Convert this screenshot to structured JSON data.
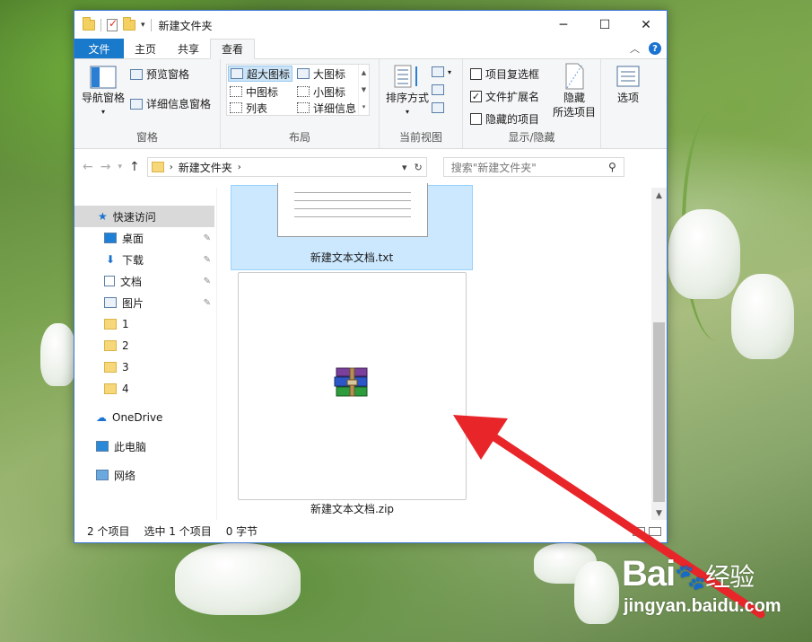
{
  "window": {
    "title": "新建文件夹",
    "controls": {
      "minimize": "─",
      "maximize": "☐",
      "close": "✕"
    }
  },
  "ribbon_tabs": {
    "file": "文件",
    "home": "主页",
    "share": "共享",
    "view": "查看",
    "help": "?"
  },
  "ribbon": {
    "panes": {
      "nav_pane": "导航窗格",
      "preview_pane": "预览窗格",
      "details_pane": "详细信息窗格",
      "label": "窗格"
    },
    "layout": {
      "items": [
        "超大图标",
        "大图标",
        "中图标",
        "小图标",
        "列表",
        "详细信息"
      ],
      "selected": "超大图标",
      "label": "布局"
    },
    "current_view": {
      "sort": "排序方式",
      "label": "当前视图"
    },
    "show_hide": {
      "item_checkboxes": "项目复选框",
      "file_extensions": "文件扩展名",
      "hidden_items": "隐藏的项目",
      "hide_selected_1": "隐藏",
      "hide_selected_2": "所选项目",
      "label": "显示/隐藏",
      "checked": {
        "item_checkboxes": false,
        "file_extensions": true,
        "hidden_items": false
      }
    },
    "options": "选项"
  },
  "address": {
    "path": "新建文件夹",
    "search_placeholder": "搜索\"新建文件夹\""
  },
  "nav": {
    "quick_access": "快速访问",
    "items": [
      "桌面",
      "下载",
      "文档",
      "图片",
      "1",
      "2",
      "3",
      "4"
    ],
    "onedrive": "OneDrive",
    "this_pc": "此电脑",
    "network": "网络"
  },
  "files": [
    {
      "name": "新建文本文档.txt",
      "icon": "text-document-icon",
      "selected": true
    },
    {
      "name": "新建文本文档.zip",
      "icon": "winrar-archive-icon",
      "selected": false
    }
  ],
  "status": {
    "count": "2 个项目",
    "selected": "选中 1 个项目",
    "size": "0 字节"
  },
  "watermark": {
    "brand": "Bai",
    "brand_suffix": "经验",
    "url": "jingyan.baidu.com"
  },
  "colors": {
    "accent": "#1979ca",
    "selection": "#cce8ff",
    "arrow": "#e8262a"
  }
}
